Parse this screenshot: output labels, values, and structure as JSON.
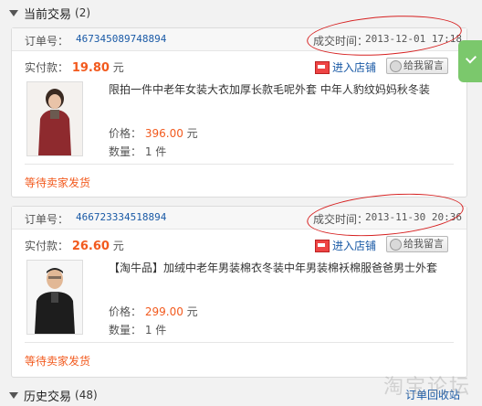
{
  "current": {
    "title": "当前交易",
    "count": "(2)"
  },
  "history": {
    "title": "历史交易",
    "count": "(48)",
    "right_link": "订单回收站"
  },
  "orders": [
    {
      "order_label": "订单号：",
      "order_no": "467345089748894",
      "time_label": "成交时间：",
      "time": "2013-12-01 17:18",
      "pay_label": "实付款：",
      "pay_amount": "19.80",
      "pay_unit": "元",
      "shop_label": "进入店铺",
      "msg_label": "给我留言",
      "product_title": "限拍一件中老年女装大衣加厚长款毛呢外套 中年人豹纹妈妈秋冬装",
      "price_label": "价格：",
      "price": "396.00",
      "price_unit": "元",
      "qty_label": "数量：",
      "qty": "1 件",
      "status": "等待卖家发货"
    },
    {
      "order_label": "订单号：",
      "order_no": "466723334518894",
      "time_label": "成交时间：",
      "time": "2013-11-30 20:36",
      "pay_label": "实付款：",
      "pay_amount": "26.60",
      "pay_unit": "元",
      "shop_label": "进入店铺",
      "msg_label": "给我留言",
      "product_title": "【淘牛品】加绒中老年男装棉衣冬装中年男装棉袄棉服爸爸男士外套",
      "price_label": "价格：",
      "price": "299.00",
      "price_unit": "元",
      "qty_label": "数量：",
      "qty": "1 件",
      "status": "等待卖家发货"
    }
  ],
  "watermark": "淘宝论坛",
  "colors": {
    "accent": "#f25a1e",
    "link": "#1a5aa6",
    "annotation": "#d62020",
    "edge_button": "#7bc86c"
  }
}
